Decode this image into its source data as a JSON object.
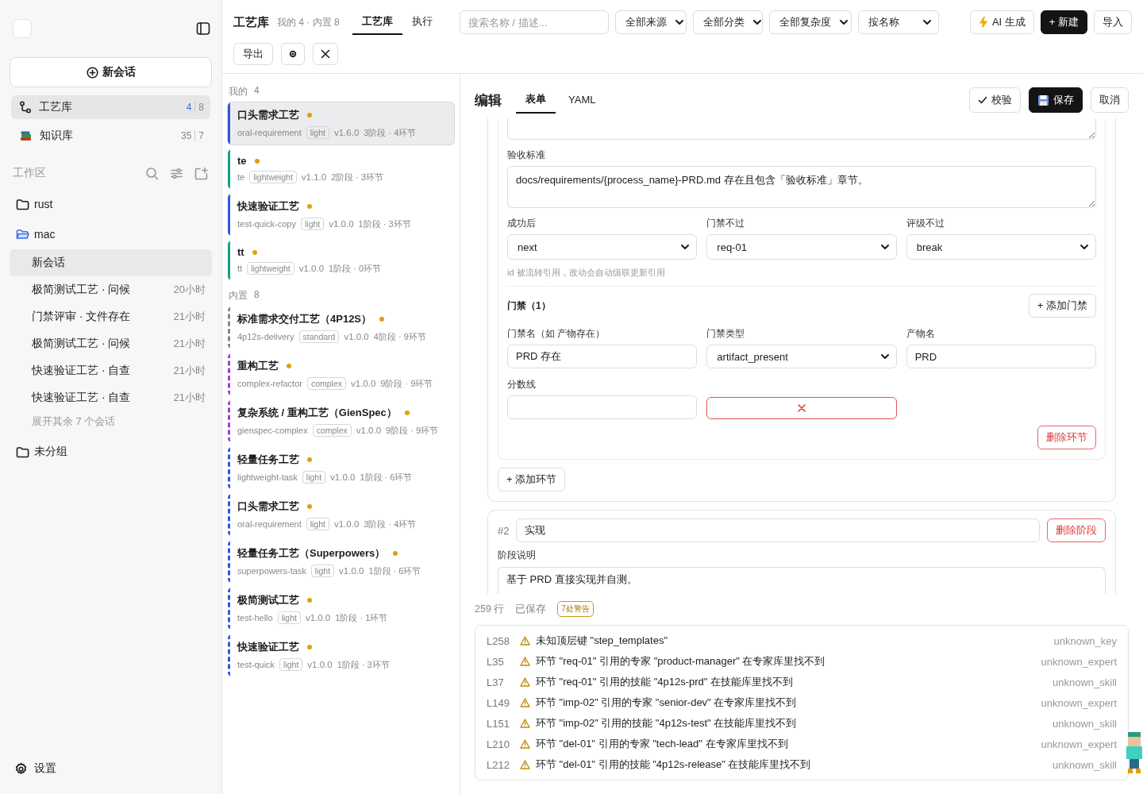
{
  "sidebar": {
    "new_chat_button": "新会话",
    "nav": [
      {
        "label": "工艺库",
        "counts": [
          "4",
          "8"
        ],
        "kind": "flow",
        "selected": true
      },
      {
        "label": "知识库",
        "counts": [
          "35",
          "7"
        ],
        "kind": "books",
        "selected": false
      }
    ],
    "workspace": {
      "title": "工作区",
      "folders": [
        {
          "name": "rust",
          "expanded": false
        },
        {
          "name": "mac",
          "expanded": true,
          "children": [
            {
              "title": "新会话",
              "selected": true
            },
            {
              "title": "极简测试工艺 · 问候",
              "time": "20小时",
              "selected": false
            },
            {
              "title": "门禁评审 · 文件存在",
              "time": "21小时",
              "selected": false
            },
            {
              "title": "极简测试工艺 · 问候",
              "time": "21小时",
              "selected": false
            },
            {
              "title": "快速验证工艺 · 自查",
              "time": "21小时",
              "selected": false
            },
            {
              "title": "快速验证工艺 · 自查",
              "time": "21小时",
              "selected": false
            }
          ],
          "more": "展开其余 7 个会话"
        },
        {
          "name": "未分组",
          "expanded": false
        }
      ]
    },
    "settings": "设置"
  },
  "topbar": {
    "title": "工艺库",
    "subtitle": "我的 4 · 内置 8",
    "tabs": [
      {
        "label": "工艺库",
        "selected": true
      },
      {
        "label": "执行",
        "selected": false
      }
    ],
    "search": {
      "placeholder": "搜索名称 / 描述..."
    },
    "filters": [
      "全部来源",
      "全部分类",
      "全部复杂度",
      "按名称"
    ],
    "buttons": [
      {
        "label": "AI 生成",
        "kind": "ai"
      },
      {
        "label": "+ 新建",
        "kind": "primary"
      },
      {
        "label": "导入",
        "kind": "default"
      }
    ],
    "actions": [
      {
        "label": "导出",
        "kind": "text"
      },
      {
        "kind": "gear"
      },
      {
        "kind": "close"
      }
    ]
  },
  "processes": [
    {
      "title": "我的",
      "count": "4",
      "kind": "mine",
      "items": [
        {
          "name": "口头需求工艺",
          "id": "oral-requirement",
          "tag": "light",
          "version": "v1.6.0",
          "stats": "3阶段 · 4环节",
          "color": "#3355dd",
          "selected": true
        },
        {
          "name": "te",
          "id": "te",
          "tag": "lightweight",
          "version": "v1.1.0",
          "stats": "2阶段 · 3环节",
          "color": "#13a08a",
          "selected": false
        },
        {
          "name": "快速验证工艺",
          "id": "test-quick-copy",
          "tag": "light",
          "version": "v1.0.0",
          "stats": "1阶段 · 3环节",
          "color": "#3355dd",
          "selected": false
        },
        {
          "name": "tt",
          "id": "tt",
          "tag": "lightweight",
          "version": "v1.0.0",
          "stats": "1阶段 · 0环节",
          "color": "#13a08a",
          "selected": false
        }
      ]
    },
    {
      "title": "内置",
      "count": "8",
      "kind": "builtin",
      "items": [
        {
          "name": "标准需求交付工艺（4P12S）",
          "id": "4p12s-delivery",
          "tag": "standard",
          "version": "v1.0.0",
          "stats": "4阶段 · 9环节",
          "color": "#888888",
          "selected": false
        },
        {
          "name": "重构工艺",
          "id": "complex-refactor",
          "tag": "complex",
          "version": "v1.0.0",
          "stats": "9阶段 · 9环节",
          "color": "#9b3fd6",
          "selected": false
        },
        {
          "name": "复杂系统 / 重构工艺（GienSpec）",
          "id": "gienspec-complex",
          "tag": "complex",
          "version": "v1.0.0",
          "stats": "9阶段 · 9环节",
          "color": "#9b3fd6",
          "selected": false
        },
        {
          "name": "轻量任务工艺",
          "id": "lightweight-task",
          "tag": "light",
          "version": "v1.0.0",
          "stats": "1阶段 · 6环节",
          "color": "#2f55e0",
          "selected": false
        },
        {
          "name": "口头需求工艺",
          "id": "oral-requirement",
          "tag": "light",
          "version": "v1.0.0",
          "stats": "3阶段 · 4环节",
          "color": "#2f55e0",
          "selected": false
        },
        {
          "name": "轻量任务工艺（Superpowers）",
          "id": "superpowers-task",
          "tag": "light",
          "version": "v1.0.0",
          "stats": "1阶段 · 6环节",
          "color": "#2f55e0",
          "selected": false
        },
        {
          "name": "极简测试工艺",
          "id": "test-hello",
          "tag": "light",
          "version": "v1.0.0",
          "stats": "1阶段 · 1环节",
          "color": "#2f55e0",
          "selected": false
        },
        {
          "name": "快速验证工艺",
          "id": "test-quick",
          "tag": "light",
          "version": "v1.0.0",
          "stats": "1阶段 · 3环节",
          "color": "#2f55e0",
          "selected": false
        }
      ]
    }
  ],
  "editor": {
    "title": "编辑",
    "tabs": [
      {
        "label": "表单",
        "selected": true
      },
      {
        "label": "YAML",
        "selected": false
      }
    ],
    "buttons": [
      {
        "label": "校验",
        "kind": "check"
      },
      {
        "label": "保存",
        "kind": "save"
      },
      {
        "label": "取消",
        "kind": "default"
      }
    ],
    "step": {
      "criteria_label": "验收标准",
      "criteria": "docs/requirements/{process_name}-PRD.md 存在且包含「验收标准」章节。",
      "routes": [
        {
          "label": "成功后",
          "value": "next"
        },
        {
          "label": "门禁不过",
          "value": "req-01"
        },
        {
          "label": "评级不过",
          "value": "break"
        }
      ],
      "hint": "id 被流转引用，改动会自动级联更新引用",
      "gates_title": "门禁（1）",
      "add_gate": "+ 添加门禁",
      "gate_fields": [
        {
          "label": "门禁名（如 产物存在）",
          "value": "PRD 存在",
          "kind": "input"
        },
        {
          "label": "门禁类型",
          "value": "artifact_present",
          "kind": "select"
        },
        {
          "label": "产物名",
          "value": "PRD",
          "kind": "input"
        },
        {
          "label": "分数线",
          "kind": "input"
        }
      ],
      "delete_step": "删除环节"
    },
    "add_step": "+ 添加环节",
    "stage": {
      "index": "#2",
      "name": "实现",
      "delete": "删除阶段",
      "desc_label": "阶段说明",
      "desc": "基于 PRD 直接实现并自测。"
    },
    "status": {
      "lines": "259 行",
      "saved": "已保存",
      "badge": "7处警告"
    },
    "warnings": [
      {
        "line": "L258",
        "message": "未知顶层键 \"step_templates\"",
        "code": "unknown_key"
      },
      {
        "line": "L35",
        "message": "环节 \"req-01\" 引用的专家 \"product-manager\" 在专家库里找不到",
        "code": "unknown_expert"
      },
      {
        "line": "L37",
        "message": "环节 \"req-01\" 引用的技能 \"4p12s-prd\" 在技能库里找不到",
        "code": "unknown_skill"
      },
      {
        "line": "L149",
        "message": "环节 \"imp-02\" 引用的专家 \"senior-dev\" 在专家库里找不到",
        "code": "unknown_expert"
      },
      {
        "line": "L151",
        "message": "环节 \"imp-02\" 引用的技能 \"4p12s-test\" 在技能库里找不到",
        "code": "unknown_skill"
      },
      {
        "line": "L210",
        "message": "环节 \"del-01\" 引用的专家 \"tech-lead\" 在专家库里找不到",
        "code": "unknown_expert"
      },
      {
        "line": "L212",
        "message": "环节 \"del-01\" 引用的技能 \"4p12s-release\" 在技能库里找不到",
        "code": "unknown_skill"
      }
    ]
  }
}
